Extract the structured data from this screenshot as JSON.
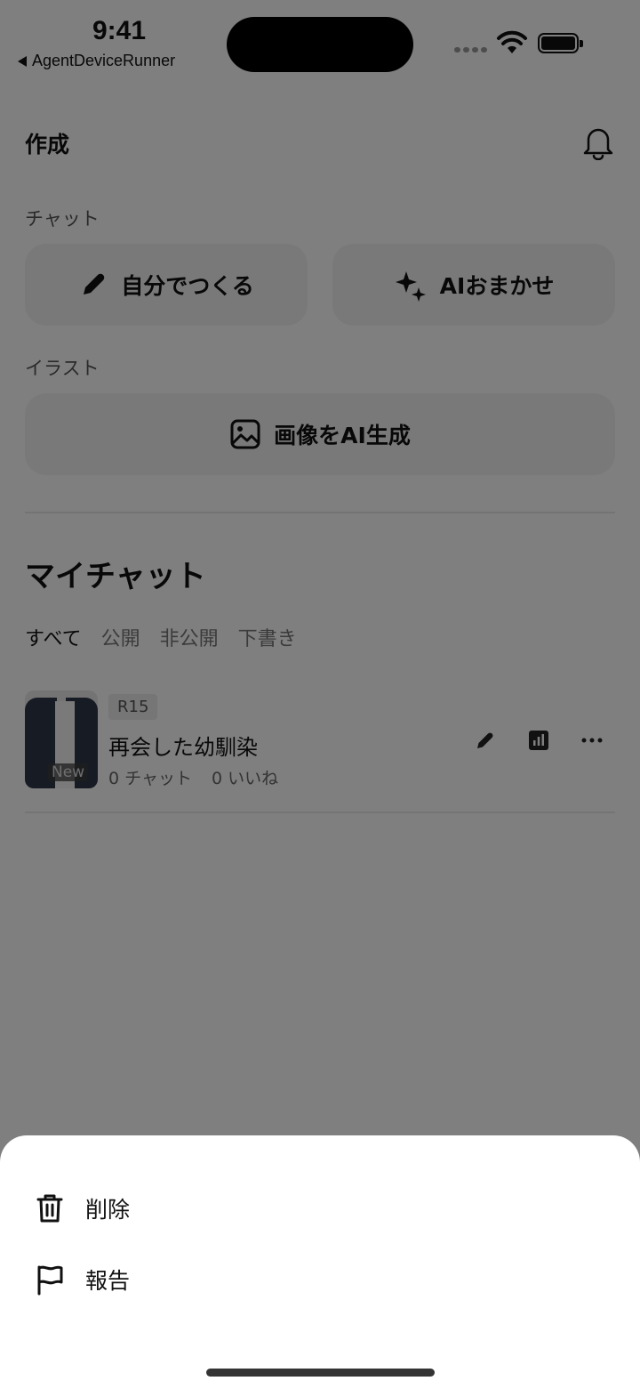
{
  "status_bar": {
    "time": "9:41",
    "back_app": "AgentDeviceRunner"
  },
  "header": {
    "title": "作成",
    "bell_icon": "bell-icon"
  },
  "chat_section": {
    "label": "チャット",
    "buttons": [
      {
        "label": "自分でつくる",
        "icon": "pencil-icon"
      },
      {
        "label": "AIおまかせ",
        "icon": "sparkles-icon"
      }
    ]
  },
  "illust_section": {
    "label": "イラスト",
    "button": {
      "label": "画像をAI生成",
      "icon": "image-icon"
    }
  },
  "my_chats": {
    "title": "マイチャット",
    "tabs": [
      "すべて",
      "公開",
      "非公開",
      "下書き"
    ],
    "active_tab": "すべて",
    "items": [
      {
        "badge": "R15",
        "thumb_badge": "New",
        "title": "再会した幼馴染",
        "chats": "0 チャット",
        "likes": "0 いいね"
      }
    ]
  },
  "sheet": {
    "items": [
      {
        "label": "削除",
        "icon": "trash-icon"
      },
      {
        "label": "報告",
        "icon": "flag-icon"
      }
    ]
  }
}
